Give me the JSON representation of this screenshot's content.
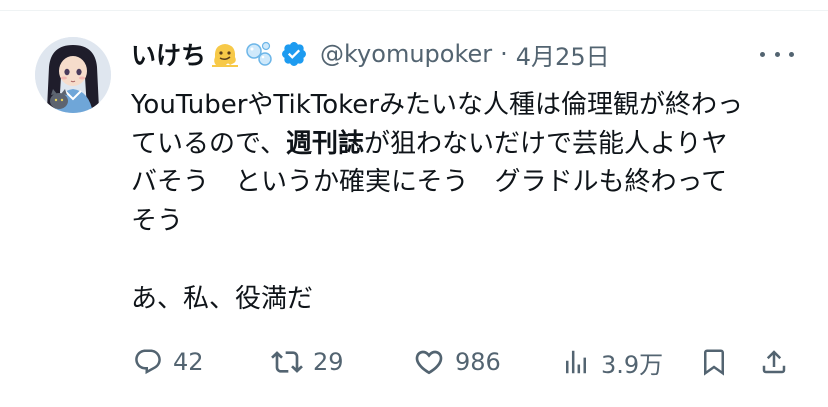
{
  "tweet": {
    "author": {
      "display_name": "いけち",
      "emoji_1": "melting-face-emoji",
      "emoji_2": "bubbles-emoji",
      "verified_icon": "verified-badge-icon",
      "handle": "@kyomupoker",
      "separator": "·",
      "date": "4月25日"
    },
    "text": {
      "line1": "YouTuberやTikTokerみたいな人種は倫理観が終わっ",
      "line2_a": "ているので、",
      "line2_bold": "週刊誌",
      "line2_b": "が狙わないだけで芸能人よりヤ",
      "line3": "バそう　というか確実にそう　グラドルも終わって",
      "line4": "そう",
      "line5": "あ、私、役満だ"
    },
    "actions": {
      "reply_count": "42",
      "retweet_count": "29",
      "like_count": "986",
      "views_count": "3.9万"
    },
    "icons": {
      "more": "more-icon",
      "reply": "reply-icon",
      "retweet": "retweet-icon",
      "like": "heart-icon",
      "views": "views-icon",
      "bookmark": "bookmark-icon",
      "share": "share-icon"
    },
    "colors": {
      "text": "#0f1419",
      "secondary": "#536471",
      "verified": "#1d9bf0",
      "border": "#eff3f4"
    }
  }
}
